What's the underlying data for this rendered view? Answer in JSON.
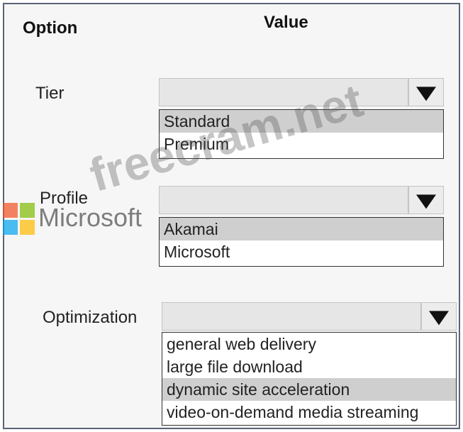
{
  "headers": {
    "option": "Option",
    "value": "Value"
  },
  "rows": [
    {
      "label": "Tier",
      "options": [
        "Standard",
        "Premium"
      ],
      "selected": "Standard"
    },
    {
      "label": "Profile",
      "options": [
        "Akamai",
        "Microsoft"
      ],
      "selected": "Akamai"
    },
    {
      "label": "Optimization",
      "options": [
        "general web delivery",
        "large file download",
        "dynamic site acceleration",
        "video-on-demand media streaming"
      ],
      "selected": "dynamic site acceleration"
    }
  ],
  "logo": {
    "text": "Microsoft",
    "colors": [
      "#f25022",
      "#7fba00",
      "#00a4ef",
      "#ffb900"
    ]
  },
  "watermark": "freecram.net",
  "icons": {
    "dropdown": "triangle-down-icon"
  }
}
